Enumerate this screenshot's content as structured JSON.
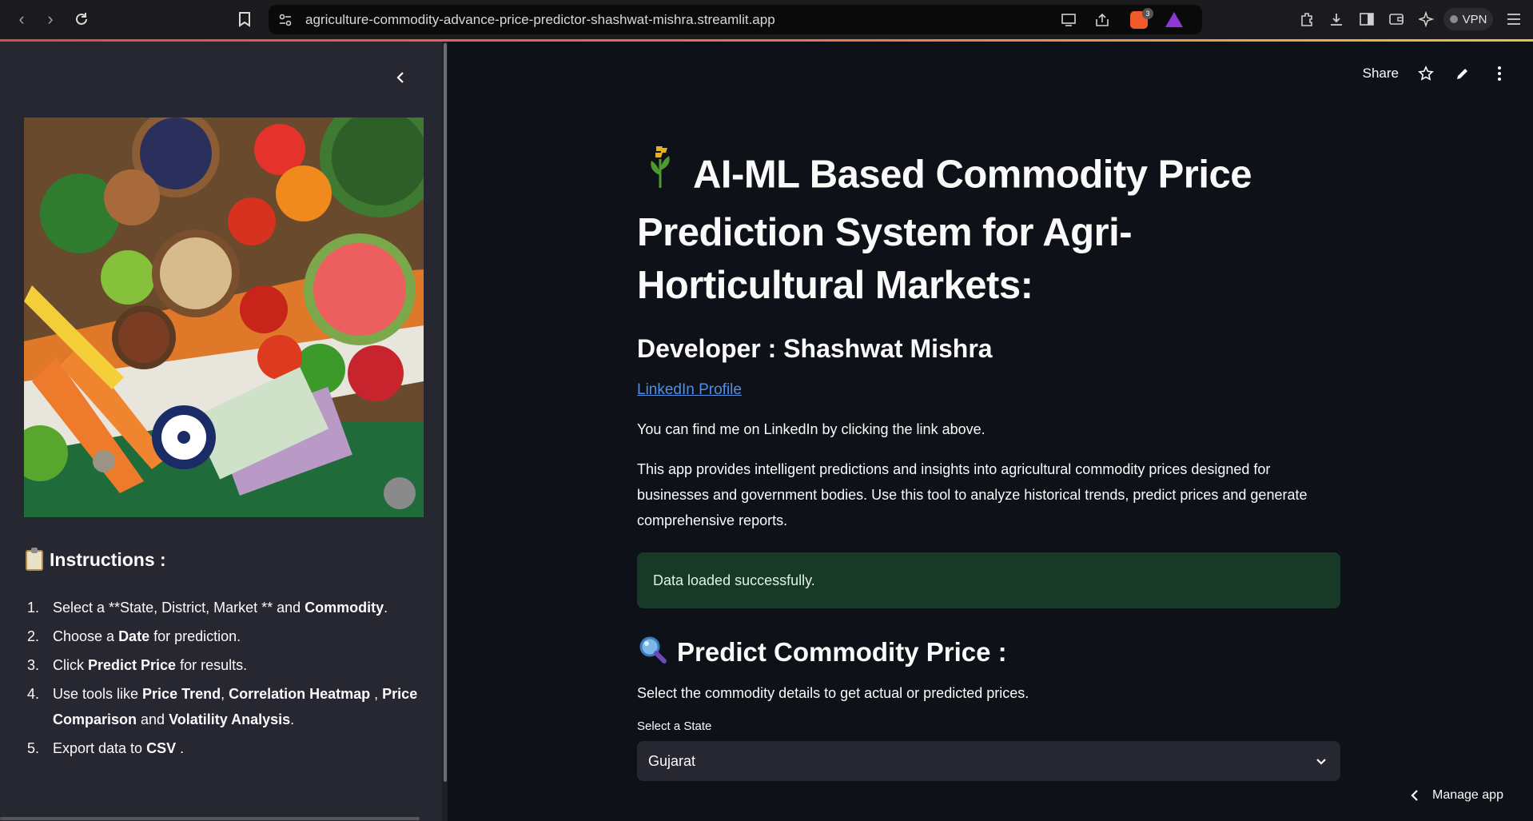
{
  "browser": {
    "url": "agriculture-commodity-advance-price-predictor-shashwat-mishra.streamlit.app",
    "brave_count": "3",
    "vpn_label": "VPN"
  },
  "sidebar": {
    "instructions_title": "Instructions :",
    "steps": [
      {
        "num": "1.",
        "parts": [
          {
            "t": "Select a **State, District, Market ** and "
          },
          {
            "b": "Commodity"
          },
          {
            "t": "."
          }
        ]
      },
      {
        "num": "2.",
        "parts": [
          {
            "t": "Choose a "
          },
          {
            "b": "Date"
          },
          {
            "t": " for prediction."
          }
        ]
      },
      {
        "num": "3.",
        "parts": [
          {
            "t": "Click "
          },
          {
            "b": "Predict Price"
          },
          {
            "t": " for results."
          }
        ]
      },
      {
        "num": "4.",
        "parts": [
          {
            "t": "Use tools like "
          },
          {
            "b": "Price Trend"
          },
          {
            "t": ", "
          },
          {
            "b": "Correlation Heatmap"
          },
          {
            "t": " , "
          },
          {
            "b": "Price Comparison"
          },
          {
            "t": " and "
          },
          {
            "b": "Volatility Analysis"
          },
          {
            "t": "."
          }
        ]
      },
      {
        "num": "5.",
        "parts": [
          {
            "t": "Export data to "
          },
          {
            "b": "CSV"
          },
          {
            "t": " ."
          }
        ]
      }
    ]
  },
  "toolbar": {
    "share_label": "Share"
  },
  "main": {
    "title": "AI-ML Based Commodity Price Prediction System for Agri-Horticultural Markets:",
    "developer": "Developer : Shashwat Mishra",
    "linkedin_label": "LinkedIn Profile",
    "para1": "You can find me on LinkedIn by clicking the link above.",
    "para2": "This app provides intelligent predictions and insights into agricultural commodity prices designed for businesses and government bodies. Use this tool to analyze historical trends, predict prices and generate comprehensive reports.",
    "success_message": "Data loaded successfully.",
    "predict_title": "Predict Commodity Price :",
    "predict_sub": "Select the commodity details to get actual or predicted prices.",
    "state_label": "Select a State",
    "state_value": "Gujarat"
  },
  "manage_app_label": "Manage app",
  "colors": {
    "background": "#0e1117",
    "sidebar": "#262730",
    "link": "#4f8fe8",
    "success_bg": "#173928"
  }
}
